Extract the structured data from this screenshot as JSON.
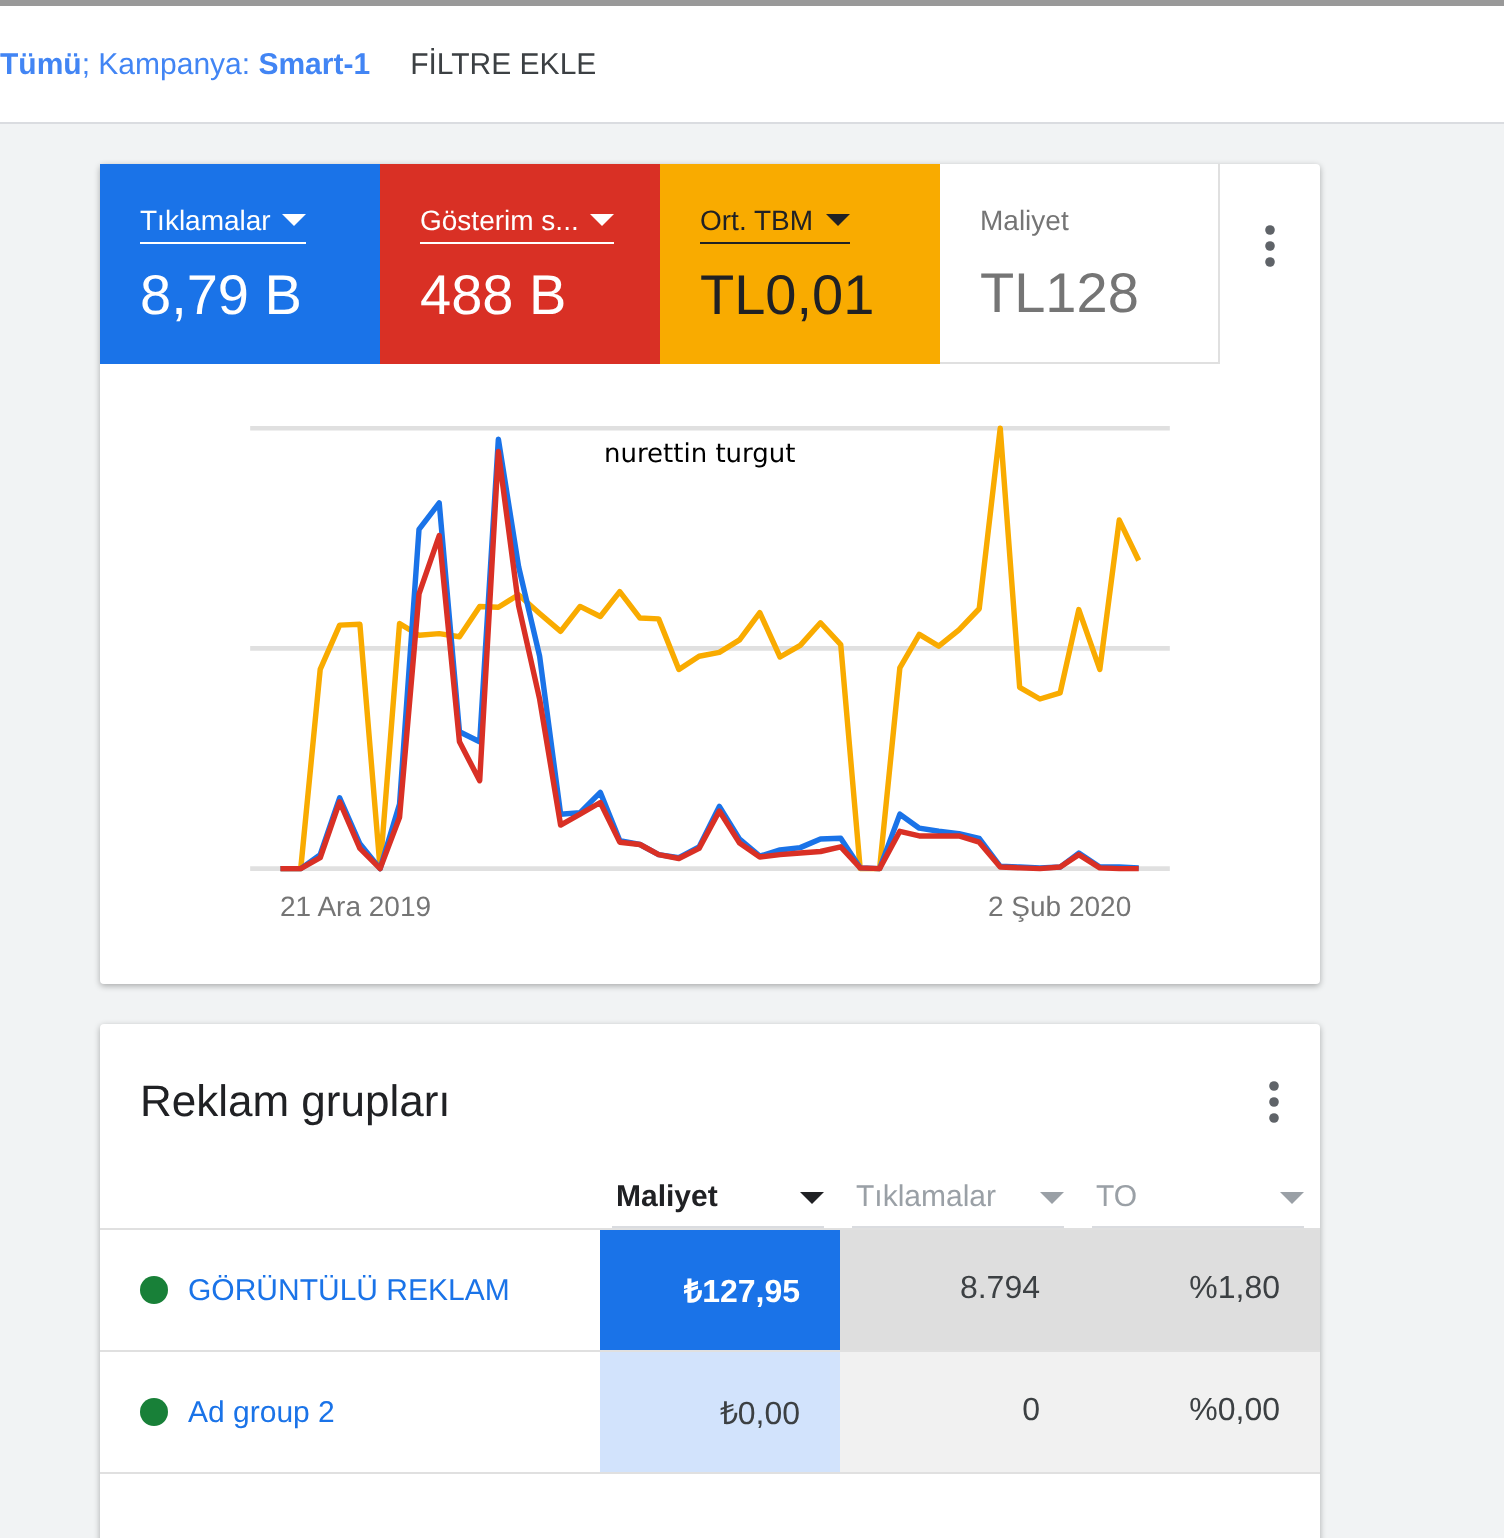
{
  "filter_bar": {
    "filter_prefix": "Tümü",
    "filter_label": "; Kampanya: ",
    "filter_value": "Smart-1",
    "add_filter": "FİLTRE EKLE"
  },
  "metrics": [
    {
      "label": "Tıklamalar",
      "value": "8,79 B",
      "selected": true,
      "color": "#1a73e8"
    },
    {
      "label": "Gösterim s...",
      "value": "488 B",
      "selected": true,
      "color": "#d93025"
    },
    {
      "label": "Ort. TBM",
      "value": "TL0,01",
      "selected": true,
      "color": "#f9ab00"
    },
    {
      "label": "Maliyet",
      "value": "TL128",
      "selected": false
    }
  ],
  "chart": {
    "annotation": "nurettin turgut",
    "x_start": "21 Ara 2019",
    "x_end": "2 Şub 2020"
  },
  "ad_groups": {
    "title": "Reklam grupları",
    "columns": [
      {
        "label": "Maliyet",
        "selected": true
      },
      {
        "label": "Tıklamalar",
        "selected": false
      },
      {
        "label": "TO",
        "selected": false
      }
    ],
    "rows": [
      {
        "name": "GÖRÜNTÜLÜ REKLAM",
        "color": "#188038",
        "cost": "₺127,95",
        "clicks": "8.794",
        "ctr": "%1,80",
        "selected": true
      },
      {
        "name": "Ad group 2",
        "color": "#188038",
        "cost": "₺0,00",
        "clicks": "0",
        "ctr": "%0,00",
        "selected": false
      }
    ]
  }
}
